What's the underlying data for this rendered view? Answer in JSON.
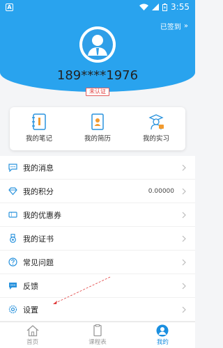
{
  "status_bar": {
    "left_badge": "A",
    "time": "3:55"
  },
  "header": {
    "signed_label": "已签到",
    "signed_chevron": "»"
  },
  "profile": {
    "phone": "189****1976",
    "badge": "未认证"
  },
  "quick_actions": [
    {
      "label": "我的笔记",
      "icon": "notebook-icon"
    },
    {
      "label": "我的简历",
      "icon": "resume-icon"
    },
    {
      "label": "我的实习",
      "icon": "internship-icon"
    }
  ],
  "menu": [
    {
      "label": "我的消息",
      "icon": "message-icon",
      "value": ""
    },
    {
      "label": "我的积分",
      "icon": "diamond-icon",
      "value": "0.00000"
    },
    {
      "label": "我的优惠券",
      "icon": "coupon-icon",
      "value": ""
    },
    {
      "label": "我的证书",
      "icon": "medal-icon",
      "value": ""
    },
    {
      "label": "常见问题",
      "icon": "question-icon",
      "value": ""
    },
    {
      "label": "反馈",
      "icon": "feedback-icon",
      "value": ""
    },
    {
      "label": "设置",
      "icon": "gear-icon",
      "value": ""
    }
  ],
  "tabs": [
    {
      "label": "首页",
      "icon": "home-icon",
      "active": false
    },
    {
      "label": "课程表",
      "icon": "schedule-icon",
      "active": false
    },
    {
      "label": "我的",
      "icon": "user-icon",
      "active": true
    }
  ],
  "colors": {
    "accent": "#29a3ee",
    "tab_active": "#1a8fe0",
    "badge_red": "#e03c3c"
  }
}
